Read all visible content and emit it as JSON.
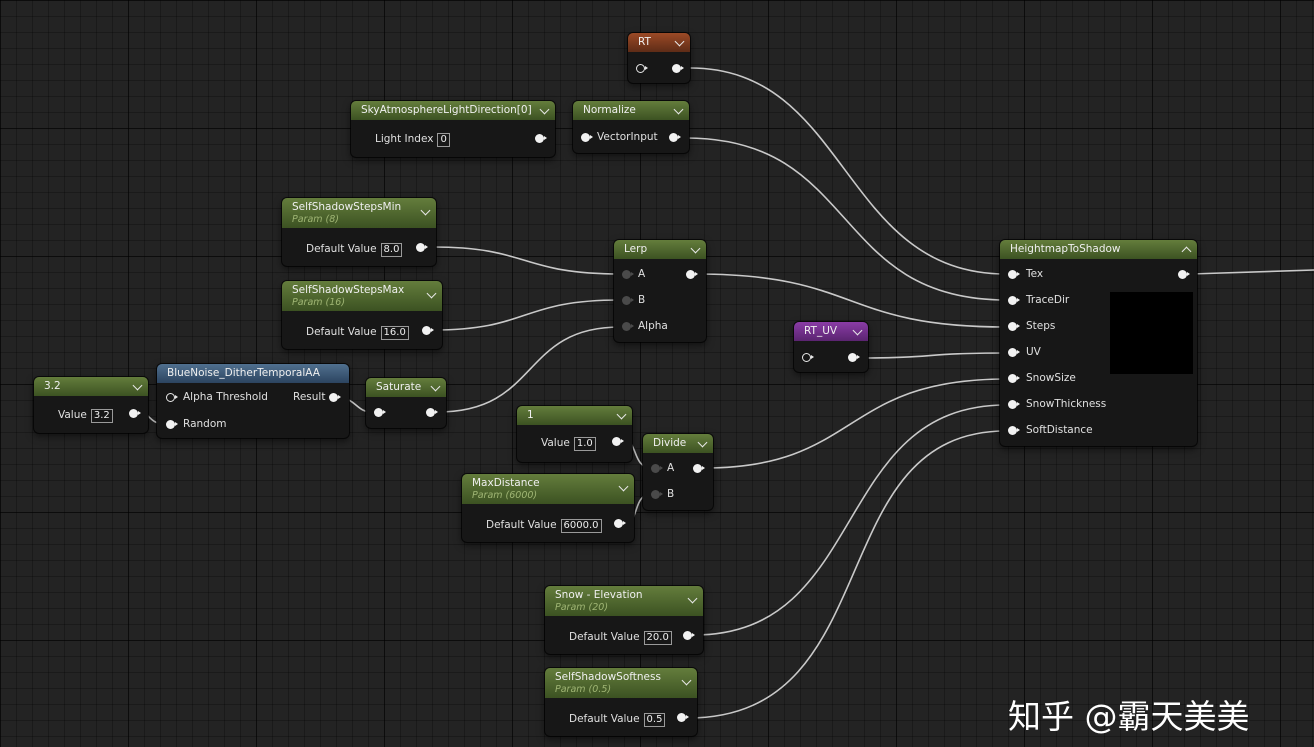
{
  "nodes": {
    "rt": {
      "title": "RT"
    },
    "sky": {
      "title": "SkyAtmosphereLightDirection[0]",
      "label": "Light Index",
      "value": "0"
    },
    "normalize": {
      "title": "Normalize",
      "label": "VectorInput"
    },
    "ssmin": {
      "title": "SelfShadowStepsMin",
      "param": "Param (8)",
      "label": "Default Value",
      "value": "8.0"
    },
    "ssmax": {
      "title": "SelfShadowStepsMax",
      "param": "Param (16)",
      "label": "Default Value",
      "value": "16.0"
    },
    "lerp": {
      "title": "Lerp",
      "a": "A",
      "b": "B",
      "alpha": "Alpha"
    },
    "const32": {
      "title": "3.2",
      "label": "Value",
      "value": "3.2"
    },
    "bluenoise": {
      "title": "BlueNoise_DitherTemporalAA",
      "alpha_threshold": "Alpha Threshold",
      "random": "Random",
      "result": "Result"
    },
    "saturate": {
      "title": "Saturate"
    },
    "const1": {
      "title": "1",
      "label": "Value",
      "value": "1.0"
    },
    "divide": {
      "title": "Divide",
      "a": "A",
      "b": "B"
    },
    "maxdist": {
      "title": "MaxDistance",
      "param": "Param (6000)",
      "label": "Default Value",
      "value": "6000.0"
    },
    "rtuv": {
      "title": "RT_UV"
    },
    "snowelev": {
      "title": "Snow - Elevation",
      "param": "Param (20)",
      "label": "Default Value",
      "value": "20.0"
    },
    "sssoft": {
      "title": "SelfShadowSoftness",
      "param": "Param (0.5)",
      "label": "Default Value",
      "value": "0.5"
    },
    "h2s": {
      "title": "HeightmapToShadow",
      "inputs": [
        "Tex",
        "TraceDir",
        "Steps",
        "UV",
        "SnowSize",
        "SnowThickness",
        "SoftDistance"
      ]
    }
  },
  "watermark": "知乎 @霸天美美",
  "colors": {
    "green_header": "#4f6a2e",
    "blue_header": "#3d5a78",
    "orange_header": "#7c3a1f",
    "purple_header": "#742e8c",
    "background": "#232323"
  }
}
